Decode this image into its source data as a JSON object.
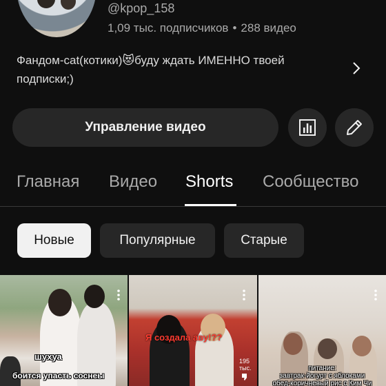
{
  "channel": {
    "handle": "@kpop_158",
    "subscribers": "1,09 тыс. подписчиков",
    "separator": "•",
    "video_count": "288 видео",
    "description_line1": "Фандом-cat(котики)😻буду ждать ИМЕННО твоей",
    "description_line2": "подписки;)"
  },
  "actions": {
    "manage_videos": "Управление видео",
    "analytics_icon": "analytics-icon",
    "edit_icon": "pencil-icon"
  },
  "tabs": [
    {
      "label": "Главная",
      "active": false
    },
    {
      "label": "Видео",
      "active": false
    },
    {
      "label": "Shorts",
      "active": true
    },
    {
      "label": "Сообщество",
      "active": false
    }
  ],
  "sort_chips": [
    {
      "label": "Новые",
      "active": true
    },
    {
      "label": "Популярные",
      "active": false
    },
    {
      "label": "Старые",
      "active": false
    }
  ],
  "shorts": [
    {
      "caption_top": "шухуа",
      "caption_bottom": "боится упасть соснеы"
    },
    {
      "caption": "Я создала аву!??",
      "views": "195 тыс."
    },
    {
      "caption_line1": "питание:",
      "caption_line2": "завтрак-йогурт с яблоками",
      "caption_line3": "обед-коричневый рис с Ким Чи"
    }
  ],
  "colors": {
    "background": "#0f0f0f",
    "button_bg": "#272727",
    "active_chip_bg": "#f1f1f1",
    "secondary_text": "#aaaaaa",
    "caption_red": "#ff3b30"
  }
}
